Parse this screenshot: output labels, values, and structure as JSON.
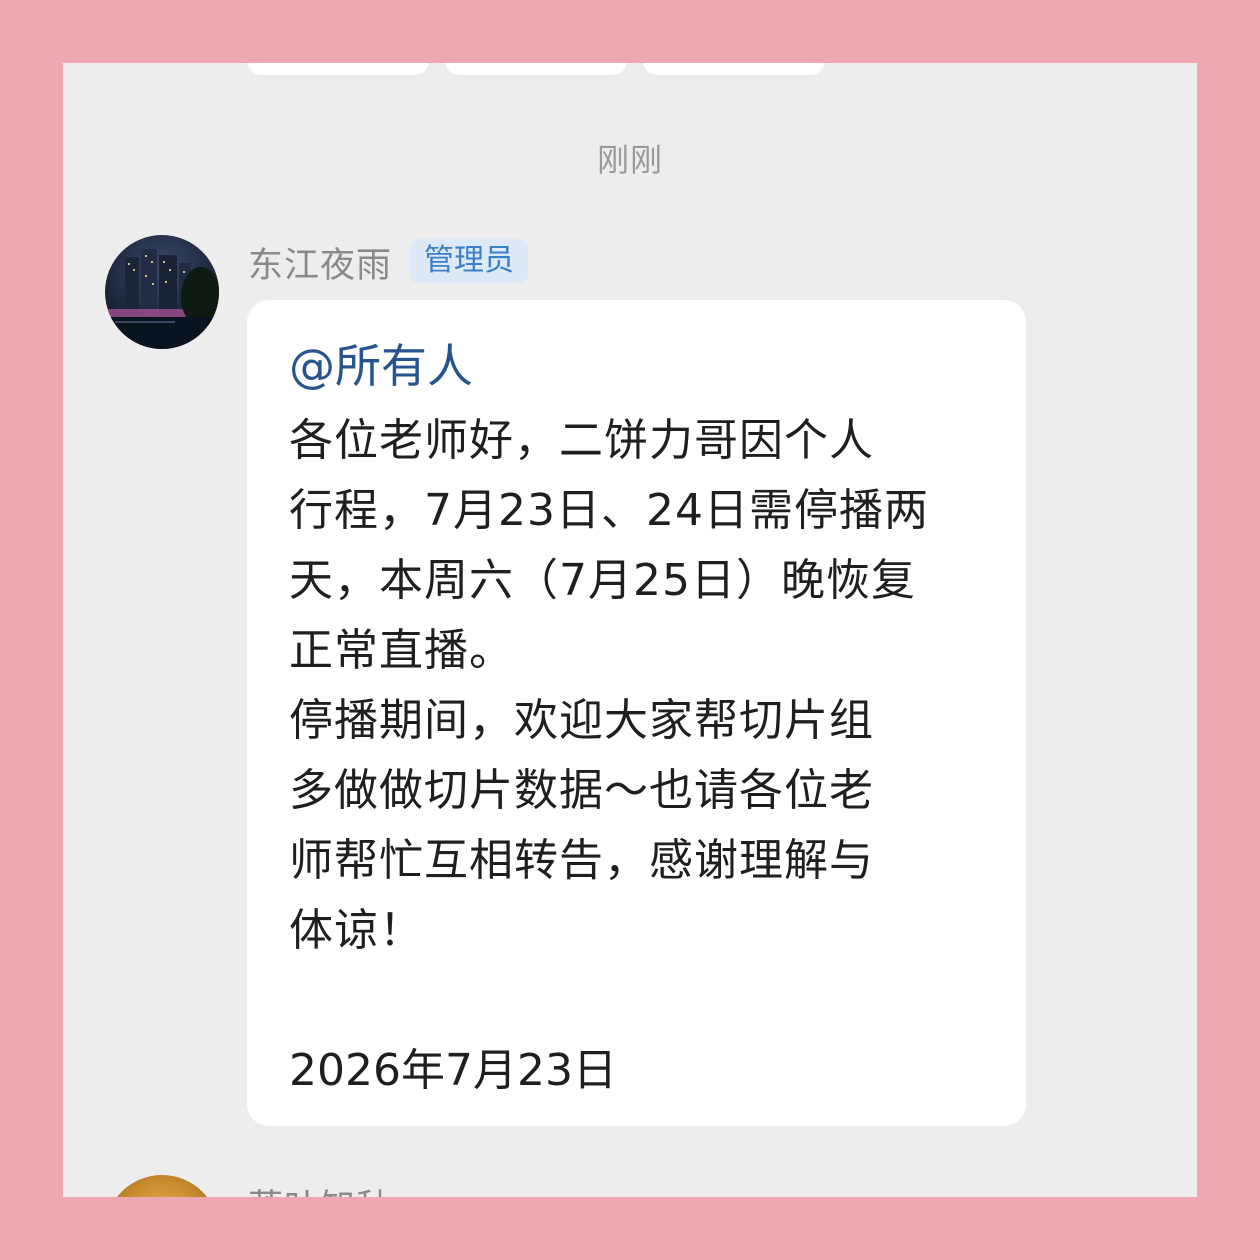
{
  "chat": {
    "timestamp": "刚刚",
    "message": {
      "sender": "东江夜雨",
      "role_badge": "管理员",
      "mention": "@所有人",
      "lines": [
        "各位老师好，二饼力哥因个人",
        "行程，7月23日、24日需停播两",
        "天，本周六（7月25日）晚恢复",
        "正常直播。",
        "停播期间，欢迎大家帮切片组",
        "多做做切片数据～也请各位老",
        "师帮忙互相转告，感谢理解与",
        "体谅！"
      ],
      "date": "2026年7月23日"
    },
    "next_message": {
      "sender": "落叶知秋"
    }
  },
  "colors": {
    "frame": "#eea8b2",
    "background": "#ededed",
    "bubble": "#ffffff",
    "mention": "#25548f",
    "badge_bg": "#dde9f6",
    "badge_text": "#3a7fc8"
  }
}
